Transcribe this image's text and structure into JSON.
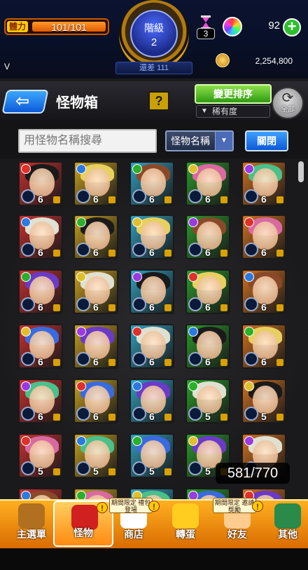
{
  "header": {
    "stamina_tag": "體力",
    "stamina_value": "101/101",
    "stamina_fraction": 1.0,
    "rank_label": "階級",
    "rank_number": "2",
    "rank_gap": "還差 111",
    "version_mark": "V",
    "hourglass_count": "3",
    "orb_count": "92",
    "orb_plus": "+",
    "coin_amount": "2,254,800",
    "icons": [
      "hourglass-icon",
      "orb-icon",
      "plus-icon",
      "coin-icon"
    ]
  },
  "titlebar": {
    "back_arrow": "⇦",
    "title": "怪物箱",
    "help": "?",
    "sort_button": "變更排序",
    "sort_current": "稀有度",
    "all_label": "全部"
  },
  "search": {
    "placeholder": "用怪物名稱搜尋",
    "select_value": "怪物名稱",
    "close_label": "關閉"
  },
  "grid": {
    "levels": [
      "6",
      "6",
      "6",
      "6",
      "6",
      "6",
      "6",
      "6",
      "6",
      "6",
      "6",
      "6",
      "6",
      "6",
      "6",
      "6",
      "6",
      "6",
      "6",
      "6",
      "6",
      "6",
      "6",
      "5",
      "5",
      "5",
      "5",
      "5",
      "5",
      ""
    ],
    "element_colors": [
      "#e0302a",
      "#2a7ae0",
      "#2ab02a",
      "#e0c02a",
      "#9a3ae0"
    ],
    "box_count": "581/770"
  },
  "nav": {
    "items": [
      {
        "label": "主選單",
        "tag": ""
      },
      {
        "label": "怪物",
        "tag": ""
      },
      {
        "label": "商店",
        "tag": "期間限定 禮包登場"
      },
      {
        "label": "轉蛋",
        "tag": ""
      },
      {
        "label": "好友",
        "tag": "期間限定 邀請獎勵"
      },
      {
        "label": "其他",
        "tag": ""
      }
    ],
    "bang": "!"
  }
}
